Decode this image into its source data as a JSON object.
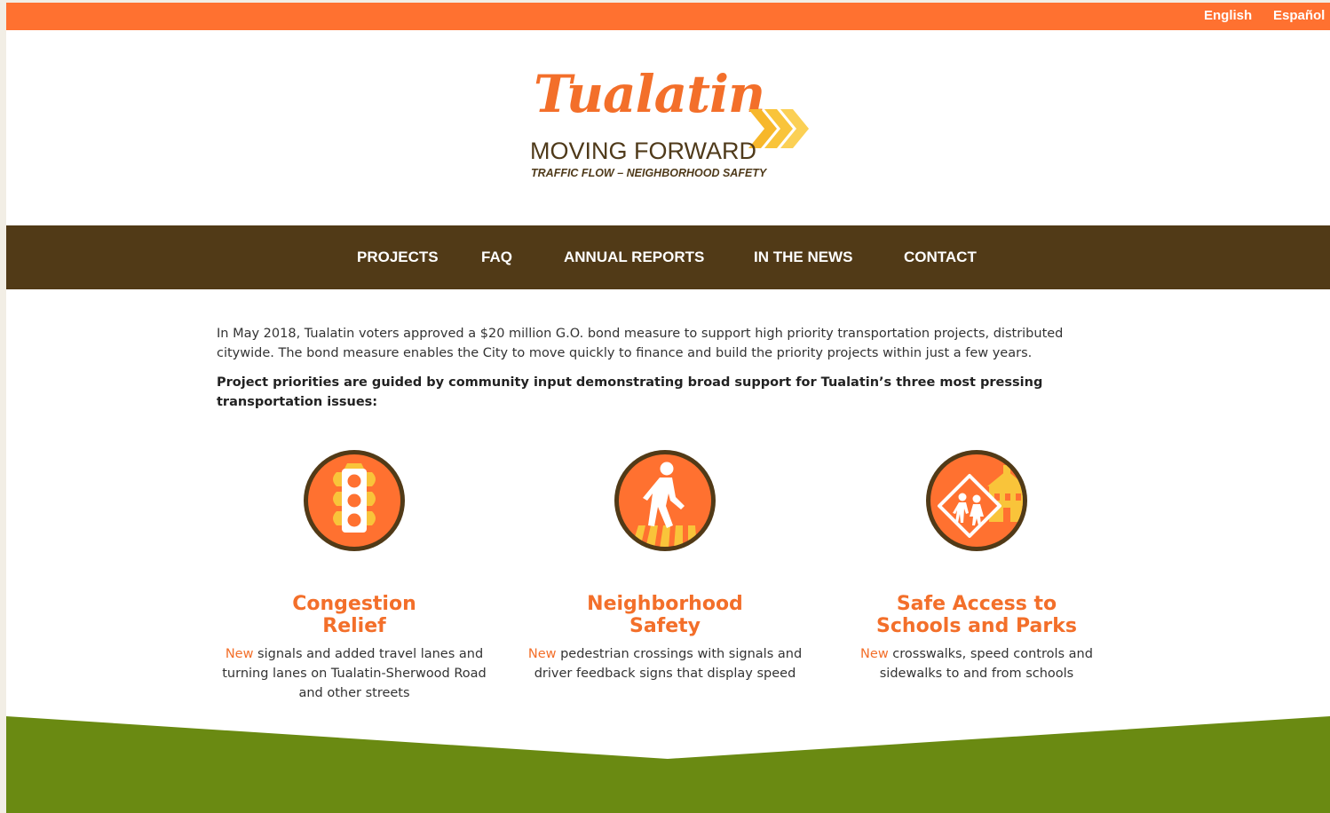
{
  "colors": {
    "orange": "#ff7130",
    "brown": "#513a17",
    "green": "#6a8a12",
    "accent_text": "#f36f2a"
  },
  "languages": [
    "English",
    "Español"
  ],
  "logo": {
    "script": "Tualatin",
    "main": "MOVING FORWARD",
    "tagline": "TRAFFIC FLOW – NEIGHBORHOOD SAFETY"
  },
  "nav": [
    "PROJECTS",
    "FAQ",
    "ANNUAL REPORTS",
    "IN THE NEWS",
    "CONTACT"
  ],
  "intro": {
    "paragraph": "In May 2018, Tualatin voters approved a $20 million G.O. bond measure to support high priority transportation projects, distributed citywide. The bond measure enables the City to move quickly to finance and build the priority projects within just a few years.",
    "priorities": "Project priorities are guided by community input demonstrating broad support for Tualatin’s three most pressing transportation issues:"
  },
  "features": [
    {
      "icon": "traffic-light-icon",
      "title_line1": "Congestion",
      "title_line2": "Relief",
      "new_word": "New",
      "description": " signals and added travel lanes and turning lanes on Tualatin-Sherwood Road and other streets"
    },
    {
      "icon": "pedestrian-icon",
      "title_line1": "Neighborhood",
      "title_line2": "Safety",
      "new_word": "New",
      "description": " pedestrian crossings with signals and driver feedback signs that display speed"
    },
    {
      "icon": "school-crossing-icon",
      "title_line1": "Safe Access to",
      "title_line2": "Schools and Parks",
      "new_word": "New",
      "description": " crosswalks, speed controls and sidewalks to and from schools"
    }
  ]
}
